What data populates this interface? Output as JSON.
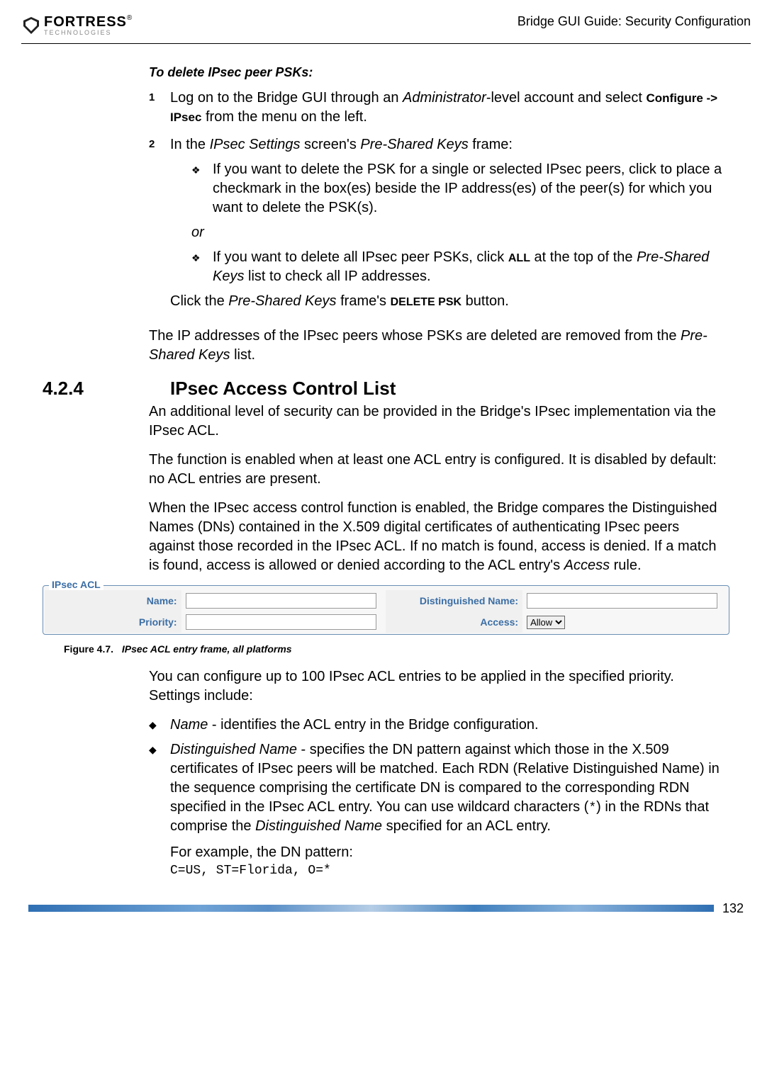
{
  "header": {
    "logo_main": "FORTRESS",
    "logo_sub": "TECHNOLOGIES",
    "logo_reg": "®",
    "doc_title": "Bridge GUI Guide: Security Configuration"
  },
  "delete_heading": "To delete IPsec peer PSKs:",
  "step1": {
    "num": "1",
    "t1": "Log on to the Bridge GUI through an ",
    "t2": "Administrator",
    "t3": "-level account and select ",
    "t4": "Configure -> IPsec",
    "t5": " from the menu on the left."
  },
  "step2": {
    "num": "2",
    "t1": "In the ",
    "t2": "IPsec Settings",
    "t3": " screen's ",
    "t4": "Pre-Shared Keys",
    "t5": " frame:"
  },
  "sub1": "If you want to delete the PSK for a single or selected IPsec peers, click to place a checkmark in the box(es) beside the IP address(es) of the peer(s) for which you want to delete the PSK(s).",
  "or": "or",
  "sub2": {
    "t1": "If you want to delete all IPsec peer PSKs, click ",
    "t2": "ALL",
    "t3": " at the top of the ",
    "t4": "Pre-Shared Keys",
    "t5": " list to check all IP addresses."
  },
  "click_line": {
    "t1": "Click the ",
    "t2": "Pre-Shared Keys",
    "t3": " frame's ",
    "t4": "DELETE PSK",
    "t5": " button."
  },
  "result_para": {
    "t1": "The IP addresses of the IPsec peers whose PSKs are deleted are removed from the ",
    "t2": "Pre-Shared Keys",
    "t3": " list."
  },
  "section": {
    "num": "4.2.4",
    "title": "IPsec Access Control List"
  },
  "acl_p1": "An additional level of security can be provided in the Bridge's IPsec implementation via the IPsec ACL.",
  "acl_p2": "The function is enabled when at least one ACL entry is configured. It is disabled by default: no ACL entries are present.",
  "acl_p3": {
    "t1": "When the IPsec access control function is enabled, the Bridge compares the Distinguished Names (DNs) contained in the X.509 digital certificates of authenticating IPsec peers against those recorded in the IPsec ACL. If no match is found, access is denied. If a match is found, access is allowed or denied according to the ACL entry's ",
    "t2": "Access",
    "t3": " rule."
  },
  "fieldset": {
    "legend": "IPsec ACL",
    "name_label": "Name:",
    "dn_label": "Distinguished Name:",
    "priority_label": "Priority:",
    "access_label": "Access:",
    "access_value": "Allow",
    "name_value": "",
    "dn_value": "",
    "priority_value": ""
  },
  "figure": {
    "label": "Figure 4.7.",
    "text": "IPsec ACL entry frame, all platforms"
  },
  "after_fig": "You can configure up to 100 IPsec ACL entries to be applied in the specified priority. Settings include:",
  "bullet_name": {
    "t1": "Name",
    "t2": " - identifies the ACL entry in the Bridge configuration."
  },
  "bullet_dn": {
    "t1": "Distinguished Name",
    "t2": " - specifies the DN pattern against which those in the X.509 certificates of IPsec peers will be matched. Each RDN (Relative Distinguished Name) in the sequence comprising the certificate DN is compared to the corresponding RDN specified in the IPsec ACL entry. You can use wildcard characters (",
    "t3": "*",
    "t4": ") in the RDNs that comprise the ",
    "t5": "Distinguished Name",
    "t6": " specified for an ACL entry."
  },
  "dn_example_intro": "For example, the DN pattern:",
  "dn_example_code": "C=US, ST=Florida, O=*",
  "page_number": "132"
}
